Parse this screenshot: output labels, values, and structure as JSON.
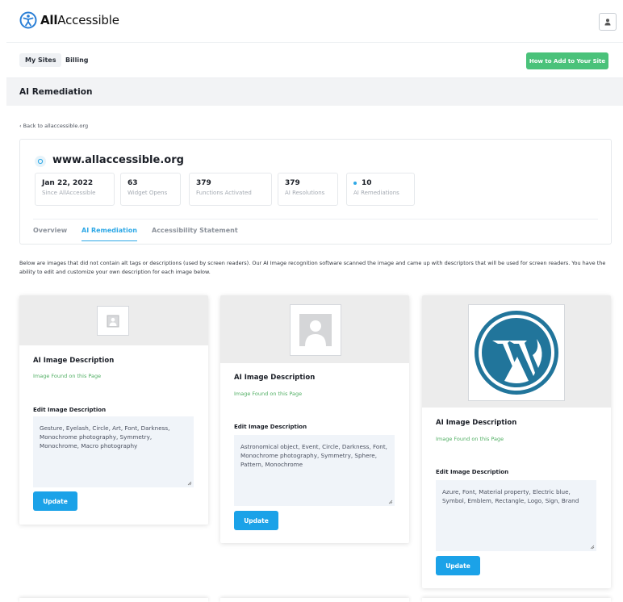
{
  "brand": {
    "name_bold": "All",
    "name_rest": "Accessible",
    "brand_color": "#2a7fd6"
  },
  "header": {
    "avatar_icon": "user-icon"
  },
  "nav": {
    "items": [
      {
        "label": "My Sites",
        "active": true
      },
      {
        "label": "Billing",
        "active": false
      }
    ],
    "cta_label": "How to Add to Your Site",
    "cta_color": "#4ac27a"
  },
  "page_title": "AI Remediation",
  "back_link": "‹ Back to allaccessible.org",
  "site": {
    "url": "www.allaccessible.org",
    "stats": [
      {
        "value": "Jan 22, 2022",
        "label": "Since AllAccessible"
      },
      {
        "value": "63",
        "label": "Widget Opens"
      },
      {
        "value": "379",
        "label": "Functions Activated"
      },
      {
        "value": "379",
        "label": "AI Resolutions"
      },
      {
        "value": "10",
        "label": "AI Remediations"
      }
    ],
    "tabs": [
      {
        "label": "Overview",
        "active": false
      },
      {
        "label": "AI Remediation",
        "active": true
      },
      {
        "label": "Accessibility Statement",
        "active": false
      }
    ]
  },
  "intro_text": "Below are images that did not contain alt tags or descriptions (used by screen readers). Our AI Image recognition software scanned the image and came up with descriptors that will be used for screen readers. You have the ability to edit and customize your own description for each image below.",
  "cards": [
    {
      "image": "placeholder-image-icon",
      "title": "AI Image Description",
      "found_label": "Image Found on this Page",
      "edit_label": "Edit Image Description",
      "description": "Gesture, Eyelash, Circle, Art, Font, Darkness, Monochrome photography, Symmetry, Monochrome, Macro photography",
      "button_label": "Update"
    },
    {
      "image": "user-silhouette-image",
      "title": "AI Image Description",
      "found_label": "Image Found on this Page",
      "edit_label": "Edit Image Description",
      "description": "Astronomical object, Event, Circle, Darkness, Font, Monochrome photography, Symmetry, Sphere, Pattern, Monochrome",
      "button_label": "Update"
    },
    {
      "image": "wordpress-logo-image",
      "title": "AI Image Description",
      "found_label": "Image Found on this Page",
      "edit_label": "Edit Image Description",
      "description": "Azure, Font, Material property, Electric blue, Symbol, Emblem, Rectangle, Logo, Sign, Brand",
      "button_label": "Update"
    }
  ],
  "colors": {
    "accent": "#1ba2e8",
    "found_green": "#4fae62",
    "wordpress_blue": "#21759b"
  }
}
